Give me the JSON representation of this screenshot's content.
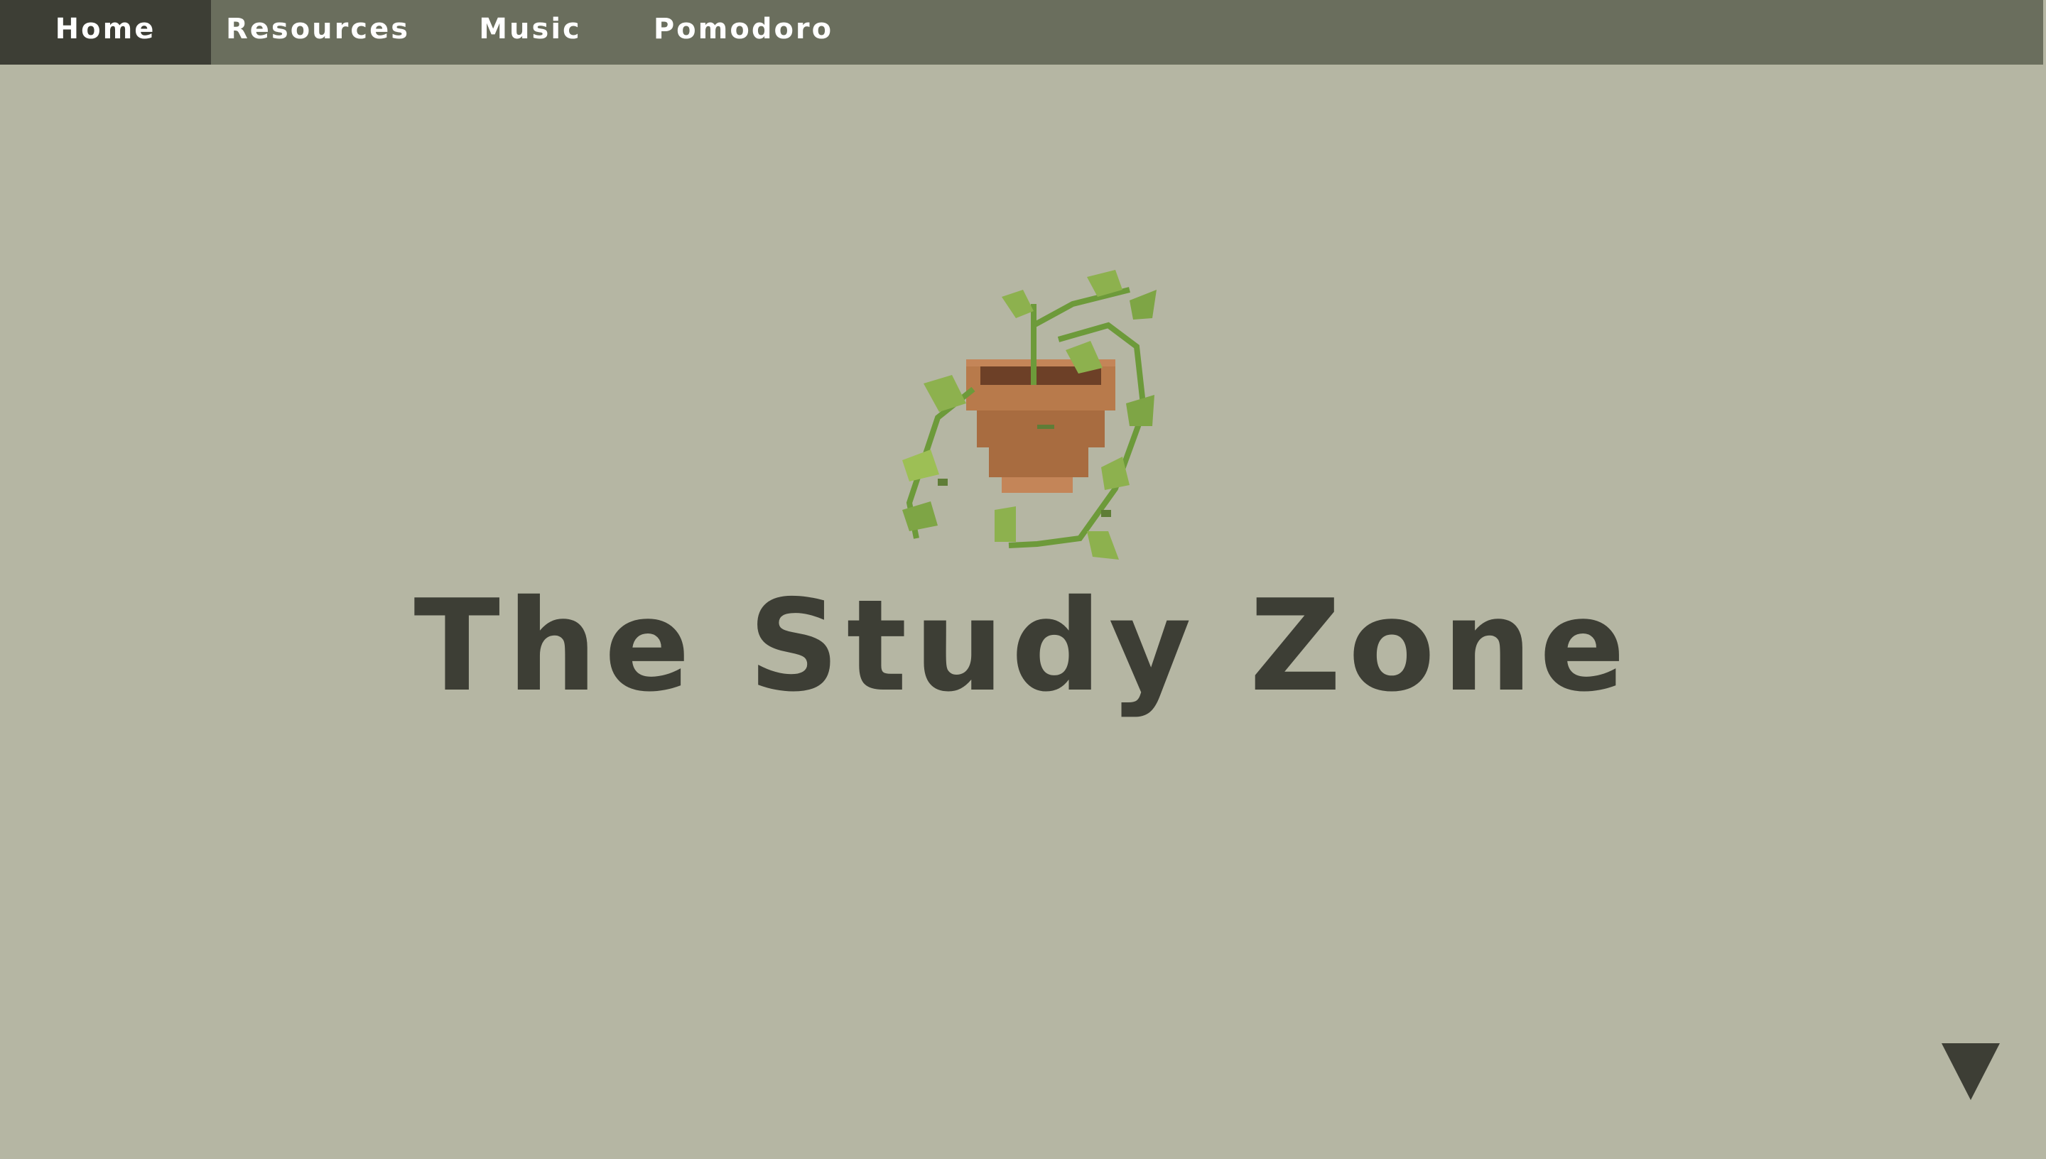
{
  "nav": {
    "items": [
      {
        "label": "Home",
        "active": true
      },
      {
        "label": "Resources",
        "active": false
      },
      {
        "label": "Music",
        "active": false
      },
      {
        "label": "Pomodoro",
        "active": false
      }
    ]
  },
  "hero": {
    "image_icon": "potted-vine-plant-icon",
    "title": "The Study Zone"
  },
  "scroll_icon": "triangle-down-icon",
  "colors": {
    "background": "#b5b6a3",
    "nav_background": "#6a6e5d",
    "nav_active": "#3d3e35",
    "title": "#3d3e35",
    "leaf_light": "#8db14e",
    "leaf_dark": "#5f7d37",
    "pot": "#b87a4b",
    "soil": "#6d4027"
  }
}
